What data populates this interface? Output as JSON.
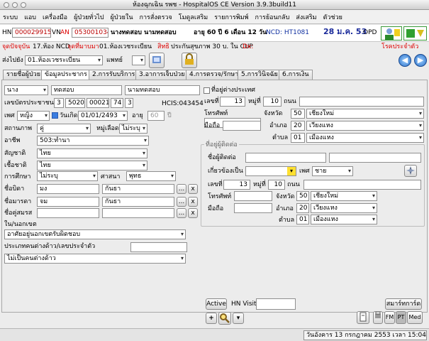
{
  "window": {
    "title": "ห้องฉุกเฉิน รพช - HospitalOS CE Version 3.9.3build11"
  },
  "menu": [
    "ระบบ",
    "แอบ",
    "เครื่องมือ",
    "ผู้ป่วยทั่วไป",
    "ผู้ป่วยใน",
    "การสั่งตรวจ",
    "โมดูลเสริม",
    "รายการพิมพ์",
    "การย้อนกลับ",
    "ส่งเสริม",
    "ตัวช่วย"
  ],
  "header": {
    "hn_label": "HN",
    "hn_value": "000029915",
    "vn_label": "VN",
    "an_label": "AN",
    "vn_value": "053001034",
    "patient": "นางทดสอบ นามทดสอบ",
    "age": "อายุ 60 ปี 6 เดือน 12 วัน",
    "ncd": "NCD: HT1081",
    "date": "28 ม.ค. 53",
    "opd": "OPD"
  },
  "info": {
    "current_label": "จุดปัจจุบัน",
    "current_value": "17.ห้อง NCD",
    "service_label": "จุดที่มาบมา",
    "service_value": "01.ห้องเวชระเบียน",
    "rights_label": "สิทธิ",
    "rights_value": "ประกันสุขภาพ 30 บ. ใน CUP",
    "dx_label": "Dx:",
    "chronic": "โรคประจำตัว"
  },
  "sendrow": {
    "label": "ส่งไปยัง",
    "select": "01.ห้องเวชระเบียน",
    "doctor_label": "แพทย์"
  },
  "tabs": [
    "รายชื่อผู้ป่วย",
    "ข้อมูลประชากร",
    "2.การรับบริการ",
    "3.อาการเจ็บป่วย",
    "4.การตรวจ/รักษา",
    "5.การวินิจฉัย",
    "6.การเงิน"
  ],
  "person": {
    "prefix": "นาง",
    "firstname": "ทดสอบ",
    "lastname": "นามทดสอบ",
    "pid_label": "เลขบัตรประชาชน",
    "pid": [
      "3",
      "5020",
      "00021",
      "74",
      "3"
    ],
    "hcis": "HCIS:043454",
    "sex_label": "เพศ",
    "sex": "หญิง",
    "dob_label": "วันเกิด:",
    "dob": "01/01/2493",
    "age_label": "อายุ",
    "age": "60",
    "age_unit": "ปี",
    "status_label": "สถานภาพ",
    "status": "คู่",
    "blood_label": "หมู่เลือด",
    "blood": "ไม่ระบุ",
    "occ_label": "อาชีพ",
    "occ": "503:ทำนา",
    "nation_label": "สัญชาติ",
    "nation": "ไทย",
    "race_label": "เชื้อชาติ",
    "race": "ไทย",
    "edu_label": "การศึกษา",
    "edu": "ไม่ระบุ",
    "religion_label": "ศาสนา",
    "religion": "พุทธ",
    "father_label": "ชื่อบิดา",
    "father_first": "มง",
    "father_last": "กันธา",
    "mother_label": "ชื่อมารดา",
    "mother_first": "จม",
    "mother_last": "กันธา",
    "spouse_label": "ชื่อคู่สมรส",
    "area_label": "ใน/นอกเขต",
    "area": "อาศัยอยู่นอกเขตรับผิดชอบ",
    "foreign_label": "ประเภทคนต่างด้าว/เลขประจำตัว",
    "foreign": "ไม่เป็นคนต่างด้าว"
  },
  "address": {
    "abroad_label": "ที่อยู่ต่างประเทศ",
    "no_label": "เลขที่",
    "no": "13",
    "moo_label": "หมู่ที่",
    "moo": "10",
    "road_label": "ถนน",
    "phone_label": "โทรศัพท์",
    "mobile_label": "มือถือ",
    "province_label": "จังหวัด",
    "province_code": "50",
    "province": "เชียงใหม่",
    "district_label": "อำเภอ",
    "district_code": "20",
    "district": "เวียงแหง",
    "sub_label": "ตำบล",
    "sub_code": "01",
    "sub": "เมืองแหง"
  },
  "contact": {
    "title": "ที่อยู่ผู้ติดต่อ",
    "name_label": "ชื่อผู้ติดต่อ",
    "rel_label": "เกี่ยวข้องเป็น",
    "sex_label": "เพศ",
    "sex": "ชาย",
    "no_label": "เลขที่",
    "no": "13",
    "moo_label": "หมู่ที่",
    "moo": "10",
    "road_label": "ถนน",
    "phone_label": "โทรศัพท์",
    "mobile_label": "มือถือ",
    "province_label": "จังหวัด",
    "province_code": "50",
    "province": "เชียงใหม่",
    "district_label": "อำเภอ",
    "district_code": "20",
    "district": "เวียงแหง",
    "sub_label": "ตำบล",
    "sub_code": "01",
    "sub": "เมืองแหง"
  },
  "bottom": {
    "active": "Active",
    "hnvisit_label": "HN Visit",
    "smartcard": "สมาร์ทการ์ด",
    "fm": "FM",
    "pt": "PT",
    "med": "Med",
    "plus": "+"
  },
  "status": "วันอังคาร 13 กรกฎาคม 2553 เวลา 15:04:50"
}
